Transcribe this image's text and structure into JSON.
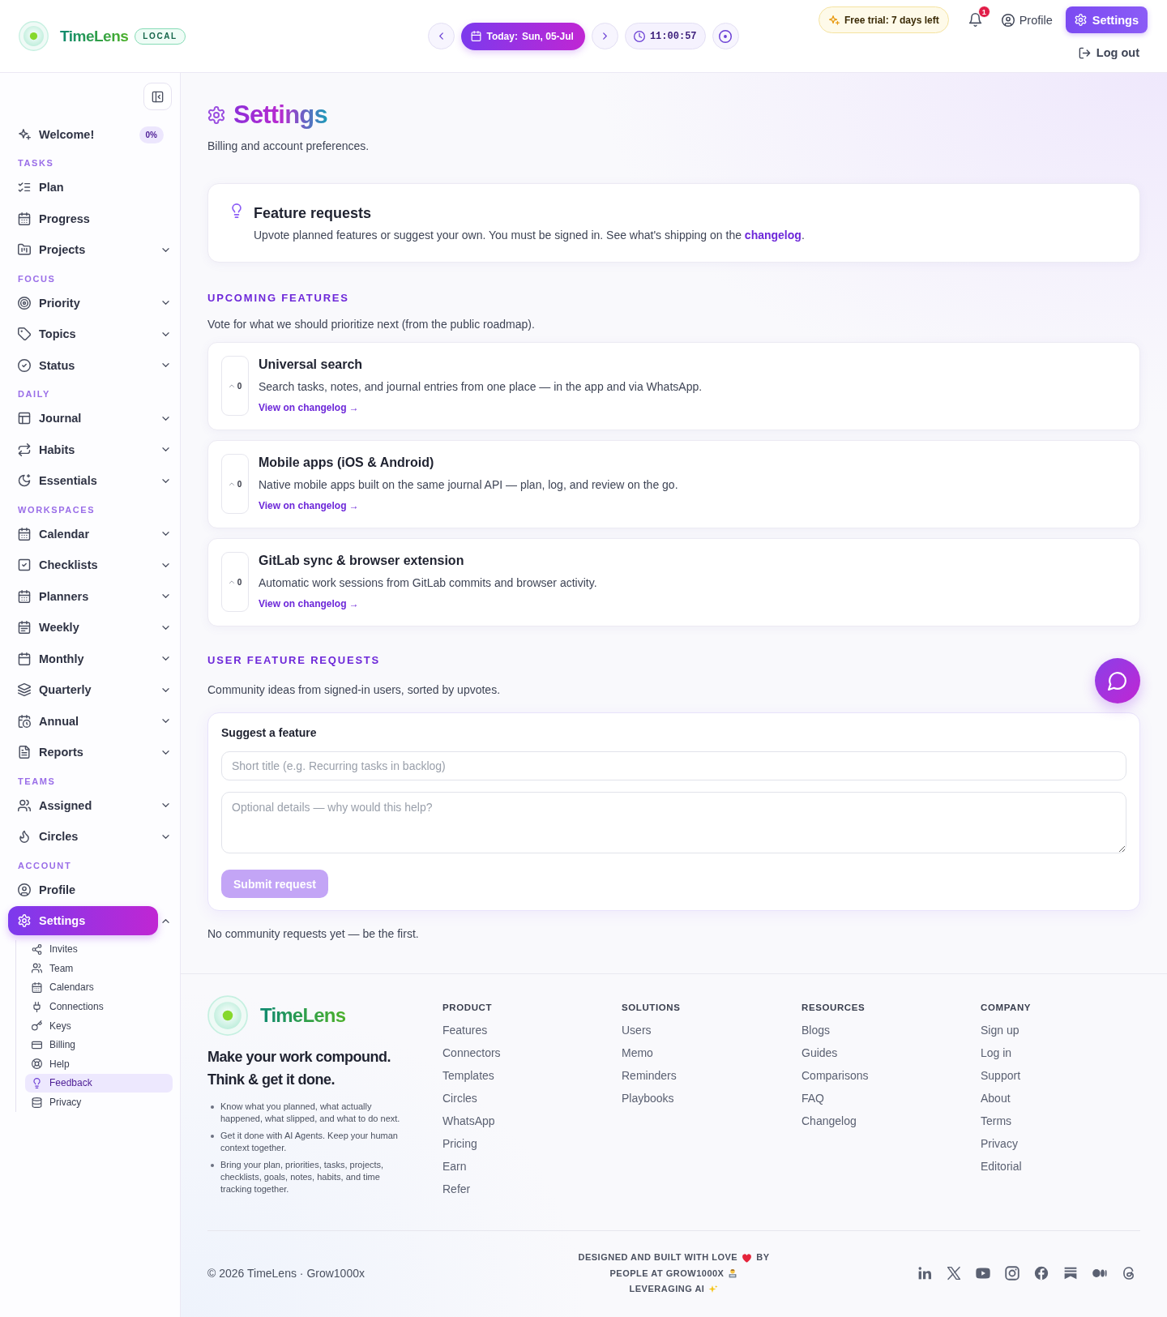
{
  "header": {
    "logo": "TimeLens",
    "badge": "LOCAL",
    "date_label": "Today:",
    "date": "Sun, 05-Jul",
    "time": "11:00:57",
    "trial": "Free trial: 7 days left",
    "notifications": "1",
    "profile": "Profile",
    "settings": "Settings",
    "logout": "Log out"
  },
  "sidebar": {
    "welcome": {
      "label": "Welcome!",
      "badge": "0%"
    },
    "sections": [
      {
        "title": "TASKS",
        "items": [
          {
            "label": "Plan",
            "kind": "link",
            "selected": false
          },
          {
            "label": "Progress",
            "kind": "link",
            "selected": false
          },
          {
            "label": "Projects",
            "kind": "group",
            "selected": false,
            "expanded": false
          }
        ]
      },
      {
        "title": "FOCUS",
        "items": [
          {
            "label": "Priority",
            "kind": "group",
            "selected": false,
            "expanded": false
          },
          {
            "label": "Topics",
            "kind": "group",
            "selected": false,
            "expanded": false
          },
          {
            "label": "Status",
            "kind": "group",
            "selected": false,
            "expanded": false
          }
        ]
      },
      {
        "title": "DAILY",
        "items": [
          {
            "label": "Journal",
            "kind": "group",
            "selected": false,
            "expanded": false
          },
          {
            "label": "Habits",
            "kind": "group",
            "selected": false,
            "expanded": false
          },
          {
            "label": "Essentials",
            "kind": "group",
            "selected": false,
            "expanded": false
          }
        ]
      },
      {
        "title": "WORKSPACES",
        "items": [
          {
            "label": "Calendar",
            "kind": "group",
            "selected": false,
            "expanded": false
          },
          {
            "label": "Checklists",
            "kind": "group",
            "selected": false,
            "expanded": false
          },
          {
            "label": "Planners",
            "kind": "group",
            "selected": false,
            "expanded": false
          },
          {
            "label": "Weekly",
            "kind": "group",
            "selected": false,
            "expanded": false
          },
          {
            "label": "Monthly",
            "kind": "group",
            "selected": false,
            "expanded": false
          },
          {
            "label": "Quarterly",
            "kind": "group",
            "selected": false,
            "expanded": false
          },
          {
            "label": "Annual",
            "kind": "group",
            "selected": false,
            "expanded": false
          },
          {
            "label": "Reports",
            "kind": "group",
            "selected": false,
            "expanded": false
          }
        ]
      },
      {
        "title": "TEAMS",
        "items": [
          {
            "label": "Assigned",
            "kind": "group",
            "selected": false,
            "expanded": false
          },
          {
            "label": "Circles",
            "kind": "group",
            "selected": false,
            "expanded": false
          }
        ]
      },
      {
        "title": "ACCOUNT",
        "items": [
          {
            "label": "Profile",
            "kind": "link",
            "selected": false
          },
          {
            "label": "Settings",
            "kind": "group",
            "selected": true,
            "expanded": true,
            "children": [
              {
                "label": "Invites",
                "selected": false
              },
              {
                "label": "Team",
                "selected": false
              },
              {
                "label": "Calendars",
                "selected": false
              },
              {
                "label": "Connections",
                "selected": false
              },
              {
                "label": "Keys",
                "selected": false
              },
              {
                "label": "Billing",
                "selected": false
              },
              {
                "label": "Help",
                "selected": false
              },
              {
                "label": "Feedback",
                "selected": true
              },
              {
                "label": "Privacy",
                "selected": false
              }
            ]
          }
        ]
      }
    ]
  },
  "page": {
    "title": "Settings",
    "subtitle": "Billing and account preferences.",
    "feature_requests_card": {
      "title": "Feature requests",
      "text": "Upvote planned features or suggest your own. You must be signed in. See what's shipping on the ",
      "link": "changelog",
      "text_end": "."
    },
    "upcoming": {
      "heading": "UPCOMING FEATURES",
      "subtitle": "Vote for what we should prioritize next (from the public roadmap).",
      "features": [
        {
          "title": "Universal search",
          "description": "Search tasks, notes, and journal entries from one place — in the app and via WhatsApp.",
          "votes": "0",
          "link": "View on changelog →"
        },
        {
          "title": "Mobile apps (iOS & Android)",
          "description": "Native mobile apps built on the same journal API — plan, log, and review on the go.",
          "votes": "0",
          "link": "View on changelog →"
        },
        {
          "title": "GitLab sync & browser extension",
          "description": "Automatic work sessions from GitLab commits and browser activity.",
          "votes": "0",
          "link": "View on changelog →"
        }
      ]
    },
    "user_requests": {
      "heading": "USER FEATURE REQUESTS",
      "subtitle": "Community ideas from signed-in users, sorted by upvotes.",
      "form": {
        "title": "Suggest a feature",
        "title_field": {
          "placeholder": "Short title (e.g. Recurring tasks in backlog)"
        },
        "details_field": {
          "placeholder": "Optional details — why would this help?"
        },
        "submit": {
          "label": "Submit request",
          "disabled": true
        }
      },
      "empty_message": "No community requests yet — be the first."
    }
  },
  "footer": {
    "logo": "TimeLens",
    "tagline": [
      "Make your work compound.",
      "Think & get it done."
    ],
    "bullets": [
      "Know what you planned, what actually happened, what slipped, and what to do next.",
      "Get it done with AI Agents. Keep your human context together.",
      "Bring your plan, priorities, tasks, projects, checklists, goals, notes, habits, and time tracking together."
    ],
    "columns": [
      {
        "title": "PRODUCT",
        "links": [
          "Features",
          "Connectors",
          "Templates",
          "Circles",
          "WhatsApp",
          "Pricing",
          "Earn",
          "Refer"
        ]
      },
      {
        "title": "SOLUTIONS",
        "links": [
          "Users",
          "Memo",
          "Reminders",
          "Playbooks"
        ]
      },
      {
        "title": "RESOURCES",
        "links": [
          "Blogs",
          "Guides",
          "Comparisons",
          "FAQ",
          "Changelog"
        ]
      },
      {
        "title": "COMPANY",
        "links": [
          "Sign up",
          "Log in",
          "Support",
          "About",
          "Terms",
          "Privacy",
          "Editorial"
        ]
      }
    ],
    "copyright": "© 2026 TimeLens · Grow1000x",
    "credit_lines": [
      [
        "DESIGNED AND BUILT WITH LOVE",
        "BY"
      ],
      [
        "PEOPLE AT GROW1000X"
      ],
      [
        "LEVERAGING AI"
      ]
    ]
  }
}
